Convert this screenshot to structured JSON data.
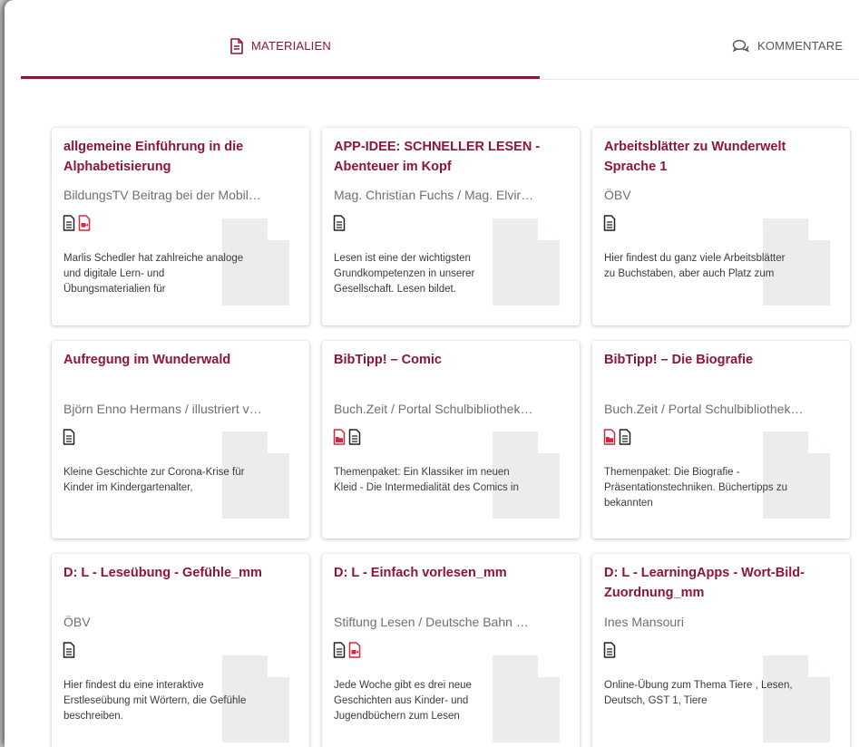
{
  "tabs": {
    "materialien": "MATERIALIEN",
    "kommentare": "KOMMENTARE"
  },
  "colors": {
    "accent": "#8e1537",
    "pdf_red": "#d7263d"
  },
  "cards": [
    {
      "title": "allgemeine Einführung in die Alphabetisierung",
      "author": "BildungsTV Beitrag bei der Mobil…",
      "icons": [
        "document-icon",
        "video-file-icon"
      ],
      "desc": "Marlis Schedler hat zahlreiche analoge und digitale Lern- und Übungsmaterialien für"
    },
    {
      "title": "APP-IDEE: SCHNELLER LESEN - Abenteuer im Kopf",
      "author": "Mag. Christian Fuchs / Mag. Elvir…",
      "icons": [
        "document-icon"
      ],
      "desc": "Lesen ist eine der wichtigsten Grundkompetenzen in unserer Gesellschaft. Lesen bildet."
    },
    {
      "title": "Arbeitsblätter zu Wunderwelt Sprache 1",
      "author": "ÖBV",
      "icons": [
        "document-icon"
      ],
      "desc": "Hier findest du ganz viele Arbeitsblätter zu Buchstaben, aber auch Platz zum"
    },
    {
      "title": "Aufregung im Wunderwald",
      "author": "Björn Enno Hermans / illustriert v…",
      "icons": [
        "document-icon"
      ],
      "desc": "Kleine Geschichte zur Corona-Krise für Kinder im Kindergartenalter,"
    },
    {
      "title": "BibTipp! – Comic",
      "author": "Buch.Zeit / Portal Schulbibliothek…",
      "icons": [
        "folder-file-icon",
        "document-icon"
      ],
      "desc": "Themenpaket: Ein Klassiker im neuen Kleid - Die Intermedialität des Comics in"
    },
    {
      "title": "BibTipp! – Die Biografie",
      "author": "Buch.Zeit / Portal Schulbibliothek…",
      "icons": [
        "folder-file-icon",
        "document-icon"
      ],
      "desc": "Themenpaket: Die Biografie - Präsentationstechniken. Büchertipps zu bekannten"
    },
    {
      "title": "D: L - Leseübung - Gefühle_mm",
      "author": "ÖBV",
      "icons": [
        "document-icon"
      ],
      "desc": "Hier findest du eine interaktive Erstleseübung mit Wörtern, die Gefühle beschreiben."
    },
    {
      "title": "D: L - Einfach vorlesen_mm",
      "author": "Stiftung Lesen / Deutsche Bahn …",
      "icons": [
        "document-icon",
        "video-file-icon"
      ],
      "desc": "Jede Woche gibt es drei neue Geschichten aus Kinder- und Jugendbüchern zum Lesen"
    },
    {
      "title": "D: L - LearningApps - Wort-Bild-Zuordnung_mm",
      "author": "Ines Mansouri",
      "icons": [
        "document-icon"
      ],
      "desc": "Online-Übung zum Thema Tiere , Lesen, Deutsch, GST 1, Tiere"
    }
  ]
}
